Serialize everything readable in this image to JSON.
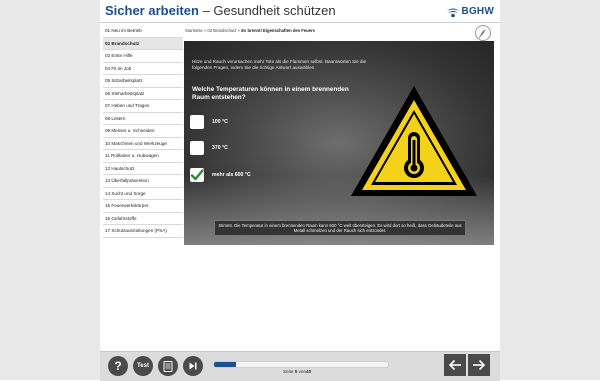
{
  "header": {
    "brand": "Sicher arbeiten",
    "separator": "–",
    "subtitle": "Gesundheit schützen",
    "logo_text": "BGHW"
  },
  "sidebar": {
    "items": [
      {
        "label": "01 Neu im Betrieb",
        "active": false
      },
      {
        "label": "02 Brandschutz",
        "active": true
      },
      {
        "label": "03 Erste Hilfe",
        "active": false
      },
      {
        "label": "04 Fit im Job",
        "active": false
      },
      {
        "label": "05 Sitzarbeitsplatz",
        "active": false
      },
      {
        "label": "06 Steharbeitsplatz",
        "active": false
      },
      {
        "label": "07 Heben und Tragen",
        "active": false
      },
      {
        "label": "08 Leitern",
        "active": false
      },
      {
        "label": "09 Messer u. Schneiden",
        "active": false
      },
      {
        "label": "10 Maschinen und Werkzeuge",
        "active": false
      },
      {
        "label": "11 Rolltainer u. Hubwagen",
        "active": false
      },
      {
        "label": "12 Hautschutz",
        "active": false
      },
      {
        "label": "13 Überfallprävention",
        "active": false
      },
      {
        "label": "14 Sucht und Sorge",
        "active": false
      },
      {
        "label": "15 Feuerwerkskörper",
        "active": false
      },
      {
        "label": "16 Gefahrstoffe",
        "active": false
      },
      {
        "label": "17 Schutzausrüstungen (PSA)",
        "active": false
      }
    ]
  },
  "breadcrumb": {
    "start": "Startseite",
    "sep1": "»",
    "chapter": "02 Brandschutz",
    "sep2": "»",
    "current": "Es brennt! Eigenschaften des Feuers"
  },
  "quiz": {
    "intro": "Hitze und Rauch verursachen mehr Tote als die Flammen selbst. Beantworten Sie die folgenden Fragen, indem Sie die richtige Antwort auswählen.",
    "question": "Welche Temperaturen können in einem brennenden Raum entstehen?",
    "options": [
      {
        "label": "100 °C",
        "checked": false
      },
      {
        "label": "370 °C",
        "checked": false
      },
      {
        "label": "mehr als 600 °C",
        "checked": true
      }
    ],
    "feedback": "Stimmt. Die Temperatur in einem brennenden Raum kann 600 °C weit übersteigen. Es wird dort so heiß, dass Gebäudeteile aus Metall schmelzen und der Rauch sich entzündet."
  },
  "icons": {
    "warning": "thermometer-warning-icon",
    "help": "question-icon",
    "test": "test-icon",
    "notes": "notes-icon",
    "skip": "skip-icon",
    "back": "arrow-left-icon",
    "forward": "arrow-right-icon"
  },
  "footer": {
    "test_label": "Test",
    "help_label": "?",
    "page_prefix": "Seite",
    "page_current": "5",
    "page_sep": "von",
    "page_total": "40",
    "progress_fraction": 0.125
  },
  "colors": {
    "brand_blue": "#1b4f8f",
    "warning_yellow": "#f5d21a",
    "check_green": "#2e8b2e",
    "button_gray": "#4a4a4a"
  }
}
